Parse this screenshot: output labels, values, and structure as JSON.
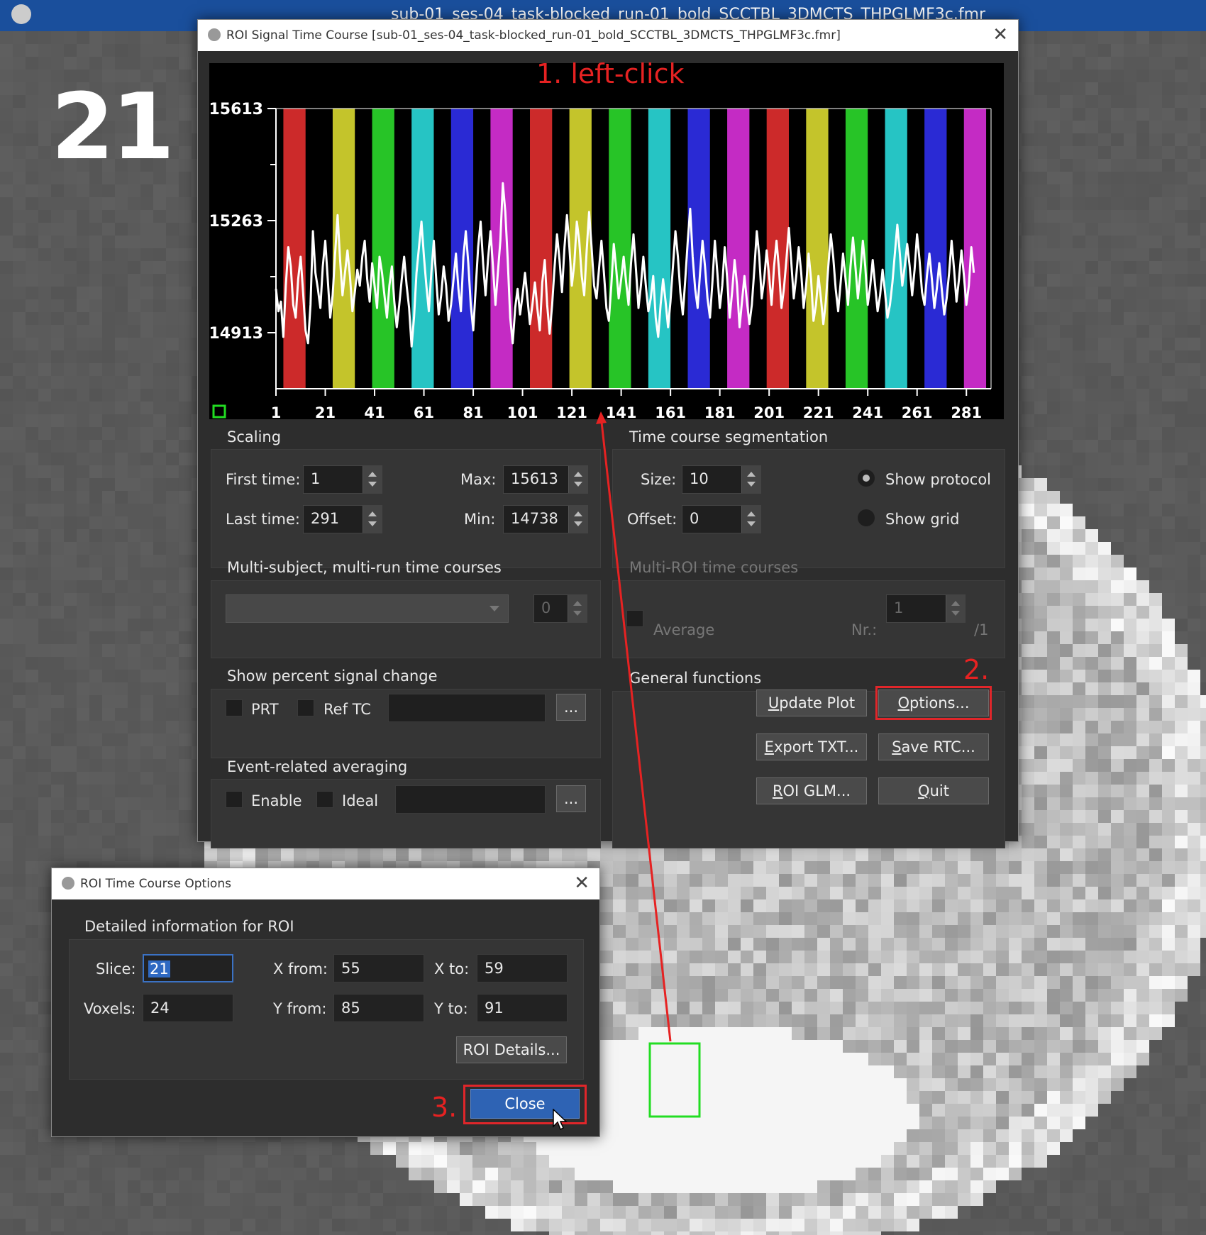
{
  "background": {
    "window_title": "sub-01_ses-04_task-blocked_run-01_bold_SCCTBL_3DMCTS_THPGLMF3c.fmr",
    "slice_number": "21"
  },
  "main_dialog": {
    "title": "ROI Signal Time Course  [sub-01_ses-04_task-blocked_run-01_bold_SCCTBL_3DMCTS_THPGLMF3c.fmr]",
    "close_icon": "close-icon"
  },
  "chart_data": {
    "type": "line",
    "y_ticks": [
      "15613",
      "15263",
      "14913"
    ],
    "x_ticks": [
      "1",
      "21",
      "41",
      "61",
      "81",
      "101",
      "121",
      "141",
      "161",
      "181",
      "201",
      "221",
      "241",
      "261",
      "281"
    ],
    "ylim": [
      14738,
      15613
    ],
    "xlim": [
      1,
      291
    ],
    "protocol_colors": [
      "#cc2a2a",
      "#c4c42b",
      "#27c427",
      "#26c4c4",
      "#2a2ad4",
      "#c42bc4"
    ],
    "protocol_blocks": [
      {
        "start": 4,
        "end": 13,
        "color": 0
      },
      {
        "start": 24,
        "end": 33,
        "color": 1
      },
      {
        "start": 40,
        "end": 49,
        "color": 2
      },
      {
        "start": 56,
        "end": 65,
        "color": 3
      },
      {
        "start": 72,
        "end": 81,
        "color": 4
      },
      {
        "start": 88,
        "end": 97,
        "color": 5
      },
      {
        "start": 104,
        "end": 113,
        "color": 0
      },
      {
        "start": 120,
        "end": 129,
        "color": 1
      },
      {
        "start": 136,
        "end": 145,
        "color": 2
      },
      {
        "start": 152,
        "end": 161,
        "color": 3
      },
      {
        "start": 168,
        "end": 177,
        "color": 4
      },
      {
        "start": 184,
        "end": 193,
        "color": 5
      },
      {
        "start": 200,
        "end": 209,
        "color": 0
      },
      {
        "start": 216,
        "end": 225,
        "color": 1
      },
      {
        "start": 232,
        "end": 241,
        "color": 2
      },
      {
        "start": 248,
        "end": 257,
        "color": 3
      },
      {
        "start": 264,
        "end": 273,
        "color": 4
      },
      {
        "start": 280,
        "end": 289,
        "color": 5
      }
    ],
    "series": [
      {
        "values": [
          15050,
          14980,
          15010,
          14900,
          15060,
          15180,
          15120,
          15000,
          14960,
          15080,
          15150,
          15040,
          14920,
          14880,
          15000,
          15230,
          15100,
          15050,
          14990,
          15120,
          15200,
          15080,
          14960,
          15030,
          15160,
          15280,
          15140,
          15030,
          15100,
          15170,
          15090,
          14980,
          15040,
          15110,
          15060,
          15150,
          15200,
          15080,
          15010,
          15130,
          15060,
          14990,
          15150,
          15100,
          15030,
          14960,
          15060,
          15120,
          15010,
          14930,
          15000,
          15080,
          15150,
          15060,
          14990,
          14870,
          14960,
          15100,
          15180,
          15260,
          15150,
          15060,
          14980,
          15100,
          15200,
          15080,
          14970,
          15030,
          15120,
          15060,
          14950,
          15000,
          15080,
          15160,
          15050,
          14980,
          15150,
          15230,
          15130,
          15000,
          14920,
          15050,
          15180,
          15260,
          15130,
          15030,
          15140,
          15230,
          15120,
          15000,
          15100,
          15200,
          15380,
          15290,
          15140,
          14960,
          14880,
          14990,
          15050,
          14970,
          15030,
          15100,
          15020,
          14940,
          15000,
          15070,
          14990,
          14920,
          15070,
          15140,
          15000,
          14910,
          15000,
          15120,
          15220,
          15140,
          15040,
          15180,
          15280,
          15180,
          15060,
          15130,
          15260,
          15200,
          15090,
          15030,
          15170,
          15290,
          15180,
          15060,
          15020,
          15110,
          15200,
          15100,
          14990,
          14950,
          15060,
          15190,
          15110,
          15020,
          15080,
          15150,
          15070,
          15000,
          15130,
          15220,
          15110,
          14990,
          15060,
          15150,
          15060,
          14980,
          15020,
          15090,
          14960,
          14900,
          15000,
          15080,
          15010,
          14930,
          15010,
          15120,
          15230,
          15150,
          15040,
          14970,
          15080,
          15200,
          15300,
          15150,
          15050,
          14990,
          15100,
          15200,
          15120,
          15020,
          14960,
          15070,
          15200,
          15100,
          14990,
          15060,
          15180,
          15080,
          14960,
          15040,
          15140,
          15060,
          14930,
          15010,
          15090,
          15010,
          14940,
          15000,
          15110,
          15230,
          15150,
          15020,
          15080,
          15170,
          15090,
          15000,
          15120,
          15200,
          15110,
          14990,
          15050,
          15140,
          15240,
          15130,
          15020,
          15090,
          15180,
          15100,
          14990,
          15060,
          15160,
          15080,
          14950,
          15000,
          15090,
          15020,
          14940,
          15010,
          15120,
          15220,
          15150,
          15050,
          14980,
          15070,
          15160,
          15080,
          15000,
          15120,
          15210,
          15120,
          15020,
          15100,
          15200,
          15120,
          15000,
          15060,
          15140,
          15060,
          14980,
          15030,
          15110,
          15040,
          14960,
          15000,
          15070,
          15160,
          15250,
          15160,
          15060,
          15120,
          15190,
          15120,
          15030,
          15110,
          15220,
          15140,
          15040,
          15000,
          15090,
          15160,
          15080,
          14990,
          15050,
          15130,
          15050,
          14970,
          15020,
          15100,
          15200,
          15110,
          15010,
          15080,
          15170,
          15090,
          15000,
          15060,
          15180,
          15100
        ]
      }
    ]
  },
  "scaling": {
    "title": "Scaling",
    "first_time_label": "First time:",
    "first_time": "1",
    "last_time_label": "Last time:",
    "last_time": "291",
    "max_label": "Max:",
    "max": "15613",
    "min_label": "Min:",
    "min": "14738"
  },
  "segmentation": {
    "title": "Time course segmentation",
    "size_label": "Size:",
    "size": "10",
    "offset_label": "Offset:",
    "offset": "0",
    "show_protocol": "Show protocol",
    "show_grid": "Show grid"
  },
  "multi_subject": {
    "title": "Multi-subject, multi-run time courses",
    "spin_value": "0"
  },
  "multi_roi": {
    "title": "Multi-ROI time courses",
    "average_label": "Average",
    "nr_label": "Nr.:",
    "nr_value": "1",
    "nr_total": "/1"
  },
  "percent_signal": {
    "title": "Show percent signal change",
    "prt_label": "PRT",
    "ref_tc_label": "Ref TC",
    "browse": "..."
  },
  "event_related": {
    "title": "Event-related averaging",
    "enable_label": "Enable",
    "ideal_label": "Ideal",
    "browse": "..."
  },
  "general_functions": {
    "title": "General functions",
    "update_plot_u": "U",
    "update_plot_rest": "pdate Plot",
    "options_u": "O",
    "options_rest": "ptions...",
    "export_u": "E",
    "export_rest": "xport TXT...",
    "save_u": "S",
    "save_rest": "ave RTC...",
    "roiglm_u": "R",
    "roiglm_rest": "OI GLM...",
    "quit_u": "Q",
    "quit_rest": "uit"
  },
  "options_dialog": {
    "title": "ROI Time Course Options",
    "group_title": "Detailed information for ROI",
    "slice_label": "Slice:",
    "slice": "21",
    "voxels_label": "Voxels:",
    "voxels": "24",
    "xfrom_label": "X from:",
    "xfrom": "55",
    "xto_label": "X to:",
    "xto": "59",
    "yfrom_label": "Y from:",
    "yfrom": "85",
    "yto_label": "Y to:",
    "yto": "91",
    "roi_details": "ROI Details...",
    "close": "Close"
  },
  "annotations": {
    "step1": "1. left-click",
    "step2": "2.",
    "step3": "3.",
    "color": "#e62222"
  }
}
